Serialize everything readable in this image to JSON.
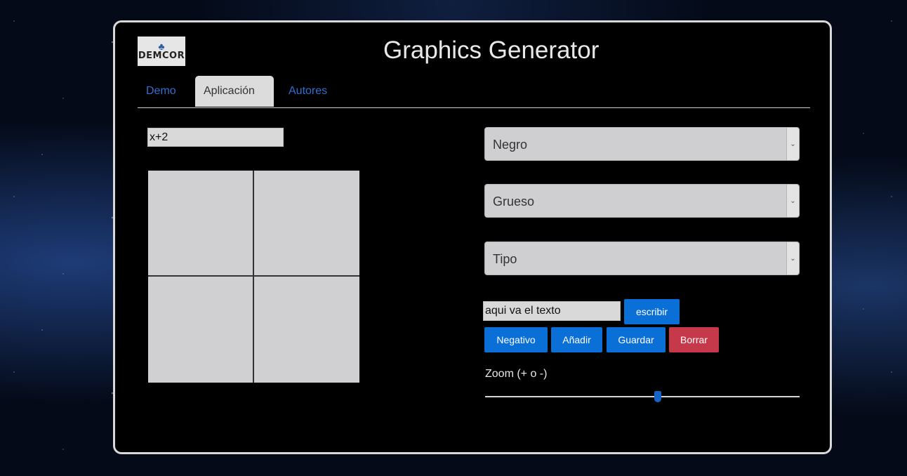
{
  "header": {
    "logo_text": "DEMCOR",
    "title": "Graphics Generator"
  },
  "tabs": [
    {
      "label": "Demo",
      "active": false
    },
    {
      "label": "Aplicación",
      "active": true
    },
    {
      "label": "Autores",
      "active": false
    }
  ],
  "function_input": {
    "value": "x+2"
  },
  "selects": {
    "color": {
      "selected": "Negro"
    },
    "thickness": {
      "selected": "Grueso"
    },
    "type": {
      "selected": "Tipo"
    }
  },
  "text_input": {
    "value": "aqui va el texto"
  },
  "buttons": {
    "write": "escribir",
    "negative": "Negativo",
    "add": "Añadir",
    "save": "Guardar",
    "clear": "Borrar"
  },
  "zoom": {
    "label": "Zoom (+ o -)",
    "value_fraction": 0.55
  },
  "colors": {
    "primary": "#0b6fd8",
    "danger": "#c5394a",
    "tab_link": "#2f6fd0"
  }
}
